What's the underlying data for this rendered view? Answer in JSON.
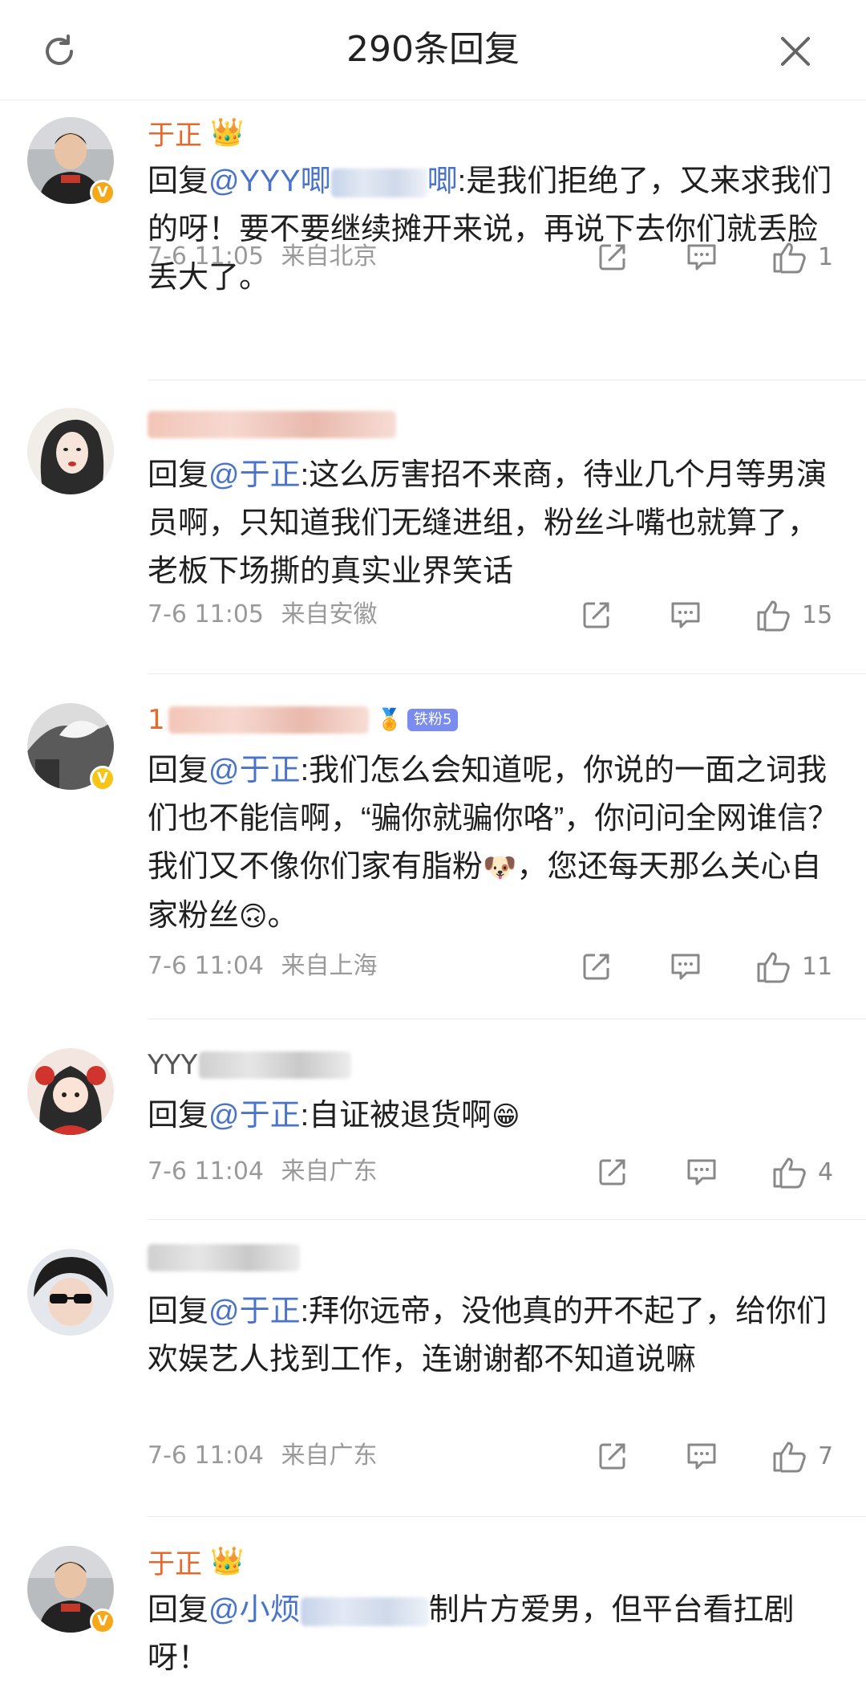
{
  "header": {
    "title": "290条回复"
  },
  "comments": [
    {
      "name": "于正",
      "reply_prefix": "回复",
      "mention": "@YYY唧",
      "mention_tail": "唧",
      "body": ":是我们拒绝了，又来求我们的呀！要不要继续摊开来说，再说下去你们就丢脸丢大了。",
      "time": "7-6 11:05",
      "location": "来自北京",
      "likes": "1"
    },
    {
      "name": "",
      "reply_prefix": "回复",
      "mention": "@于正",
      "body": ":这么厉害招不来商，待业几个月等男演员啊，只知道我们无缝进组，粉丝斗嘴也就算了，老板下场撕的真实业界笑话",
      "time": "7-6 11:05",
      "location": "来自安徽",
      "likes": "15"
    },
    {
      "name": "1",
      "fan_badge": "铁粉5",
      "reply_prefix": "回复",
      "mention": "@于正",
      "body": ":我们怎么会知道呢，你说的一面之词我们也不能信啊，“骗你就骗你咯”，你问问全网谁信？我们又不像你们家有脂粉",
      "body_end": "，您还每天那么关心自家粉丝",
      "body_final": "。",
      "time": "7-6 11:04",
      "location": "来自上海",
      "likes": "11"
    },
    {
      "name": "YYY",
      "reply_prefix": "回复",
      "mention": "@于正",
      "body": ":自证被退货啊",
      "time": "7-6 11:04",
      "location": "来自广东",
      "likes": "4"
    },
    {
      "name": "",
      "reply_prefix": "回复",
      "mention": "@于正",
      "body": ":拜你远帝，没他真的开不起了，给你们欢娱艺人找到工作，连谢谢都不知道说嘛",
      "time": "7-6 11:04",
      "location": "来自广东",
      "likes": "7"
    },
    {
      "name": "于正",
      "reply_prefix": "回复",
      "mention": "@小烦",
      "body": "制片方爱男，但平台看扛剧呀！"
    }
  ],
  "icons": {
    "refresh": "refresh-icon",
    "close": "close-icon",
    "share": "share-icon",
    "comment": "comment-icon",
    "like": "like-icon",
    "crown": "crown-icon",
    "verified": "verified-badge-icon"
  },
  "colors": {
    "name_highlight": "#e8672b",
    "mention": "#4a74c9",
    "meta": "#9a9a9a",
    "verified": "#f6a818"
  }
}
